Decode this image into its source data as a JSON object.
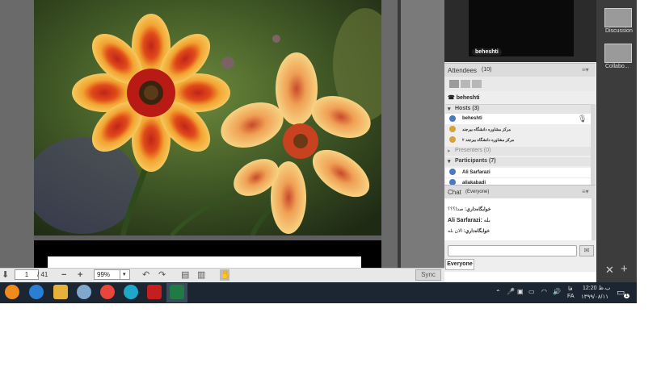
{
  "document": {
    "page_current": "1",
    "page_total": "/ 41",
    "zoom": "99%",
    "sync_label": "Sync"
  },
  "video": {
    "name_tag": "beheshti"
  },
  "attendees": {
    "title": "Attendees",
    "count": "(10)",
    "me": "beheshti",
    "hosts_label": "Hosts (3)",
    "hosts": [
      "beheshti",
      "مرکز مشاوره دانشگاه بیرجند",
      "مرکز مشاوره دانشگاه بیرجند ۲"
    ],
    "presenters_label": "Presenters (0)",
    "participants_label": "Participants (7)",
    "participants": [
      "Ali Sarfarazi",
      "aliakabadi"
    ]
  },
  "chat": {
    "title": "Chat",
    "scope": "(Everyone)",
    "messages": [
      {
        "sender": "خوابگاه‌داري:",
        "text": "صدا؟؟؟"
      },
      {
        "sender": "Ali Sarfarazi:",
        "text": "بله"
      },
      {
        "sender": "خوابگاه‌داري:",
        "text": "الان بله"
      }
    ],
    "tab": "Everyone"
  },
  "far_right": {
    "layouts": [
      "Discussion",
      "Collabo..."
    ]
  },
  "taskbar": {
    "lang": "FA",
    "lang_top": "فا",
    "time": "12:20 ب.ظ",
    "date": "۱۳۹۹/۰۸/۱۱",
    "notif_count": "1"
  },
  "colors": {
    "taskbar": "#1c2633",
    "pod_header": "#dcdcdc",
    "video_bg": "#2b2b2b",
    "far_right": "#3c3c3c"
  }
}
